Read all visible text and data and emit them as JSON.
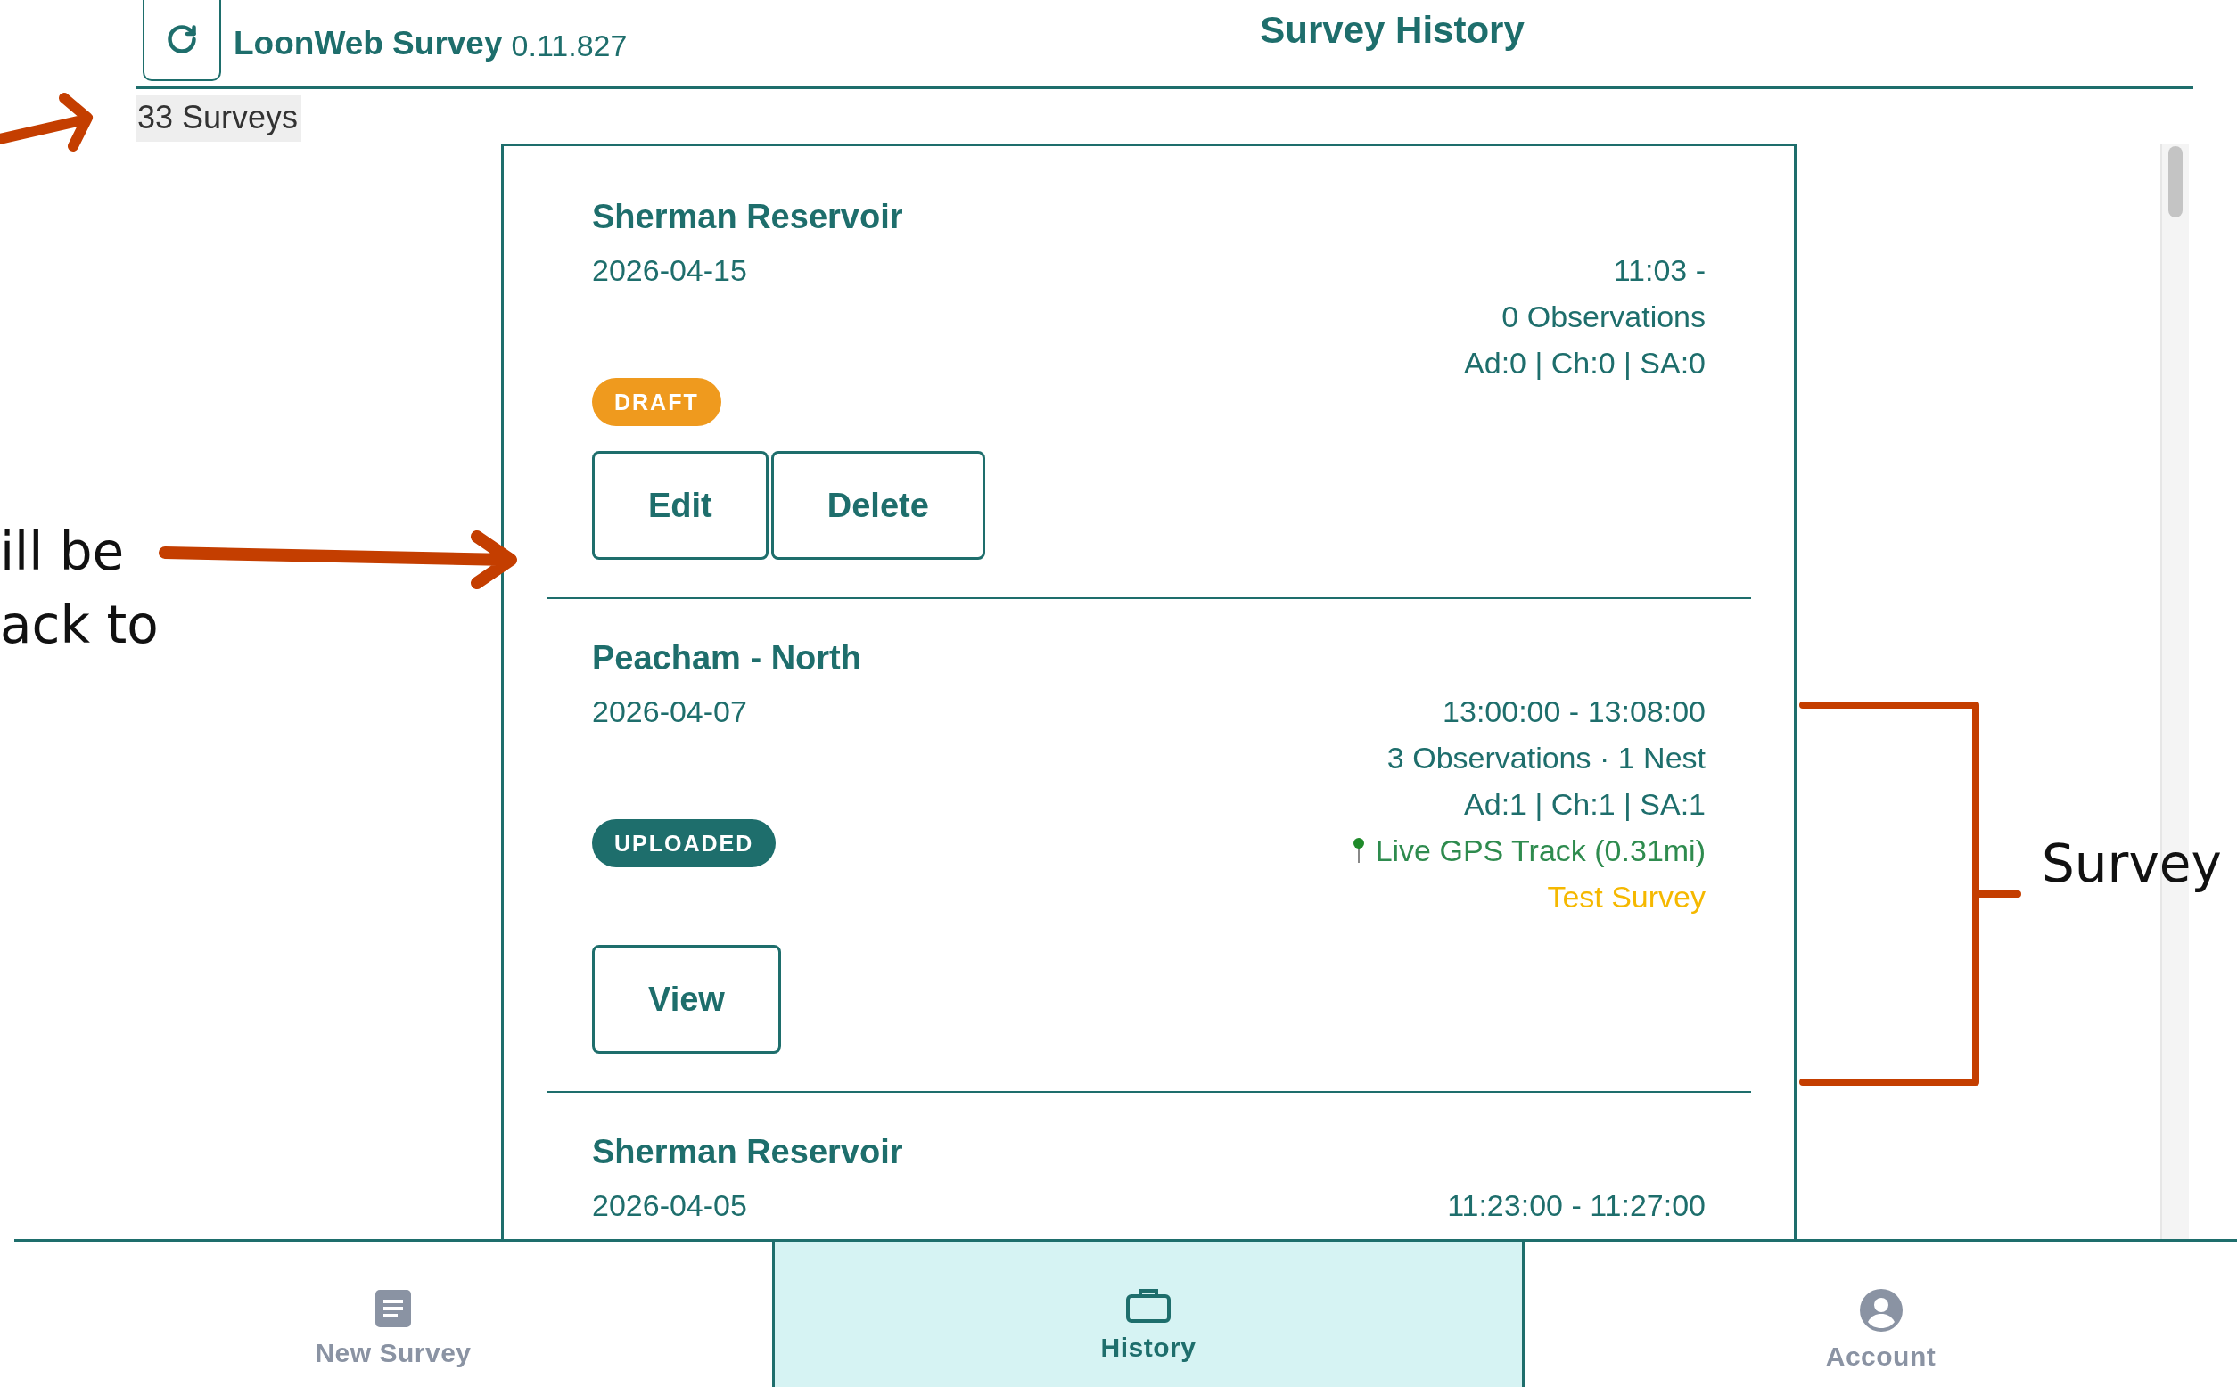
{
  "header": {
    "app_name": "LoonWeb Survey",
    "version": "0.11.827",
    "title": "Survey History"
  },
  "survey_count": "33 Surveys",
  "surveys": [
    {
      "name": "Sherman Reservoir",
      "date": "2026-04-15",
      "time": "11:03 -",
      "observations": "0 Observations",
      "counts": "Ad:0 | Ch:0 | SA:0",
      "status": {
        "kind": "draft",
        "label": "DRAFT"
      },
      "actions": [
        "Edit",
        "Delete"
      ]
    },
    {
      "name": "Peacham - North",
      "date": "2026-04-07",
      "time": "13:00:00 - 13:08:00",
      "observations": "3 Observations · 1 Nest",
      "counts": "Ad:1 | Ch:1 | SA:1",
      "gps": "Live GPS Track (0.31mi)",
      "note": "Test Survey",
      "status": {
        "kind": "uploaded",
        "label": "UPLOADED"
      },
      "actions": [
        "View"
      ]
    },
    {
      "name": "Sherman Reservoir",
      "date": "2026-04-05",
      "time": "11:23:00 - 11:27:00"
    }
  ],
  "nav": [
    {
      "kind": "document",
      "label": "New Survey",
      "selected": false
    },
    {
      "kind": "briefcase",
      "label": "History",
      "selected": true
    },
    {
      "kind": "account",
      "label": "Account",
      "selected": false
    }
  ],
  "annotations": {
    "left_note": [
      "ill be",
      "ack to"
    ],
    "right_note": "Survey"
  }
}
